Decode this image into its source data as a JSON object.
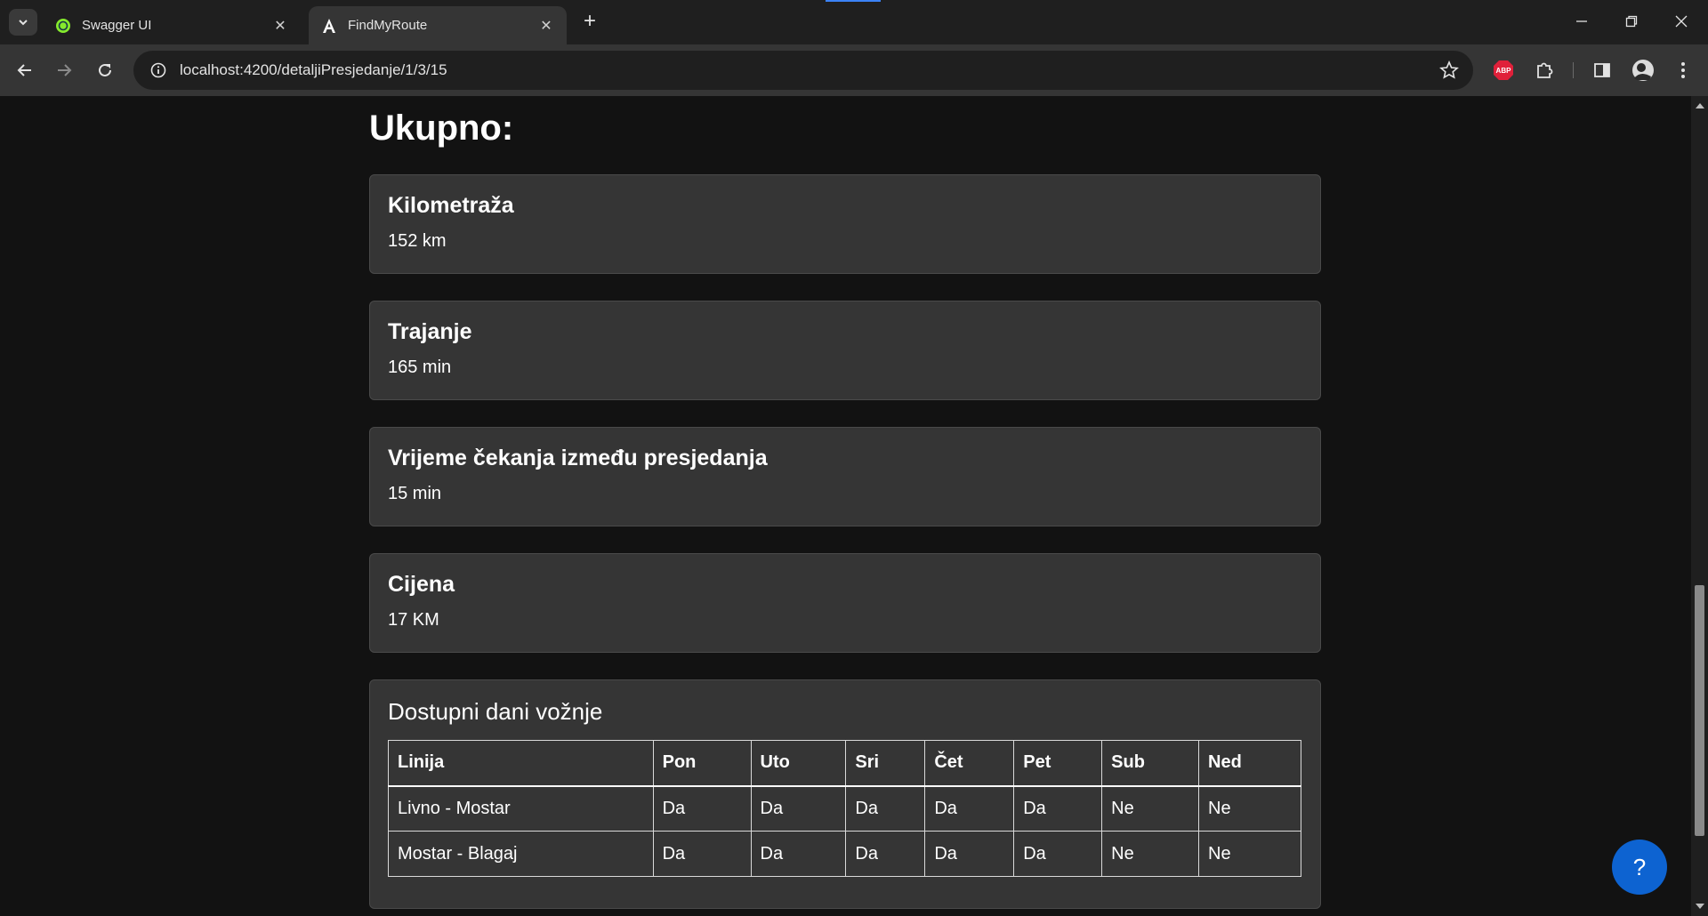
{
  "browser": {
    "tabs": [
      {
        "title": "Swagger UI",
        "active": false
      },
      {
        "title": "FindMyRoute",
        "active": true
      }
    ],
    "url": "localhost:4200/detaljiPresjedanje/1/3/15",
    "extensions": {
      "abp_label": "ABP"
    }
  },
  "page": {
    "heading": "Ukupno:",
    "cards": [
      {
        "title": "Kilometraža",
        "value": "152 km"
      },
      {
        "title": "Trajanje",
        "value": "165 min"
      },
      {
        "title": "Vrijeme čekanja između presjedanja",
        "value": "15 min"
      },
      {
        "title": "Cijena",
        "value": "17 KM"
      }
    ],
    "days": {
      "title": "Dostupni dani vožnje",
      "headers": [
        "Linija",
        "Pon",
        "Uto",
        "Sri",
        "Čet",
        "Pet",
        "Sub",
        "Ned"
      ],
      "rows": [
        [
          "Livno - Mostar",
          "Da",
          "Da",
          "Da",
          "Da",
          "Da",
          "Ne",
          "Ne"
        ],
        [
          "Mostar - Blagaj",
          "Da",
          "Da",
          "Da",
          "Da",
          "Da",
          "Ne",
          "Ne"
        ]
      ]
    },
    "help_label": "?"
  }
}
